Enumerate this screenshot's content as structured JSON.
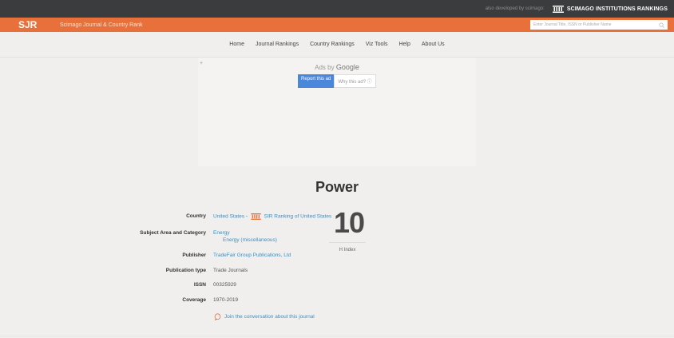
{
  "topbar": {
    "developer_text": "also developed by scimago:",
    "sir_label": "SCIMAGO INSTITUTIONS RANKINGS"
  },
  "header": {
    "logo": "SJR",
    "brand": "Scimago Journal & Country Rank",
    "search_placeholder": "Enter Journal Title, ISSN or Publisher Name"
  },
  "nav": {
    "items": [
      "Home",
      "Journal Rankings",
      "Country Rankings",
      "Viz Tools",
      "Help",
      "About Us"
    ]
  },
  "ad": {
    "close": "+",
    "ads_by": "Ads by",
    "google": "Google",
    "report": "Report this ad",
    "why": "Why this ad? ⓘ"
  },
  "journal": {
    "title": "Power",
    "country_label": "Country",
    "country_value": "United States",
    "country_sep": "-",
    "sir_country_link": "SIR Ranking of United States",
    "subject_label": "Subject Area and Category",
    "subject_area": "Energy",
    "subject_category": "Energy (miscellaneous)",
    "publisher_label": "Publisher",
    "publisher_value": "TradeFair Group Publications, Ltd",
    "pubtype_label": "Publication type",
    "pubtype_value": "Trade Journals",
    "issn_label": "ISSN",
    "issn_value": "00325929",
    "coverage_label": "Coverage",
    "coverage_value": "1970-2019",
    "h_index_value": "10",
    "h_index_label": "H Index",
    "conversation": "Join the conversation about this journal"
  },
  "colors": {
    "orange": "#e8703a",
    "topbar": "#3a3c3e",
    "link": "#3b8fc5"
  }
}
